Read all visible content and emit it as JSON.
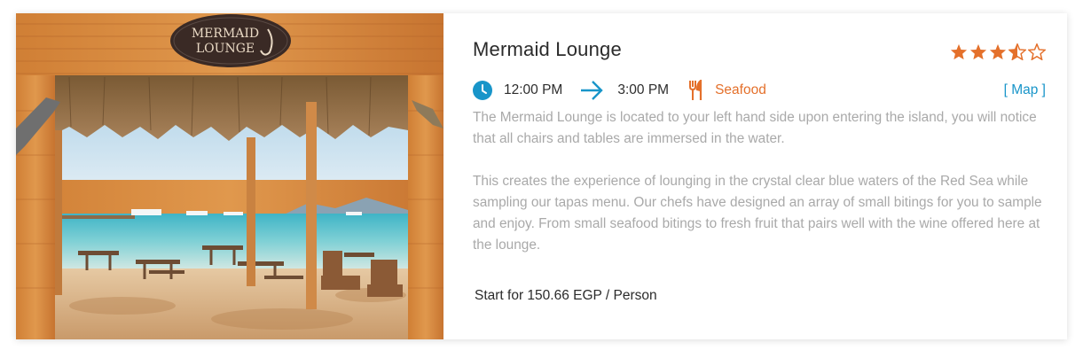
{
  "restaurant": {
    "name": "Mermaid Lounge",
    "image_sign_text": "MERMAID LOUNGE",
    "rating": 3.5,
    "rating_max": 5,
    "open_time": "12:00 PM",
    "close_time": "3:00 PM",
    "cuisine": "Seafood",
    "map_link": "[ Map ]",
    "description": [
      "The Mermaid Lounge is located to your left hand side upon entering the island, you will notice that all chairs and tables are immersed in the water.",
      "This creates the experience of lounging in the crystal clear blue waters of the Red Sea while sampling our tapas menu. Our chefs have designed an array of small bitings for you to sample and enjoy. From small seafood bitings to fresh fruit that pairs well with the wine offered here at the lounge."
    ],
    "price": "Start for 150.66 EGP / Person"
  },
  "colors": {
    "accent_orange": "#e4702b",
    "accent_blue": "#1895c9",
    "star_color": "#e4702b"
  },
  "icons": {
    "time": "clock-icon",
    "range": "arrow-right-icon",
    "cuisine": "fork-knife-icon",
    "rating": "star-icon"
  }
}
